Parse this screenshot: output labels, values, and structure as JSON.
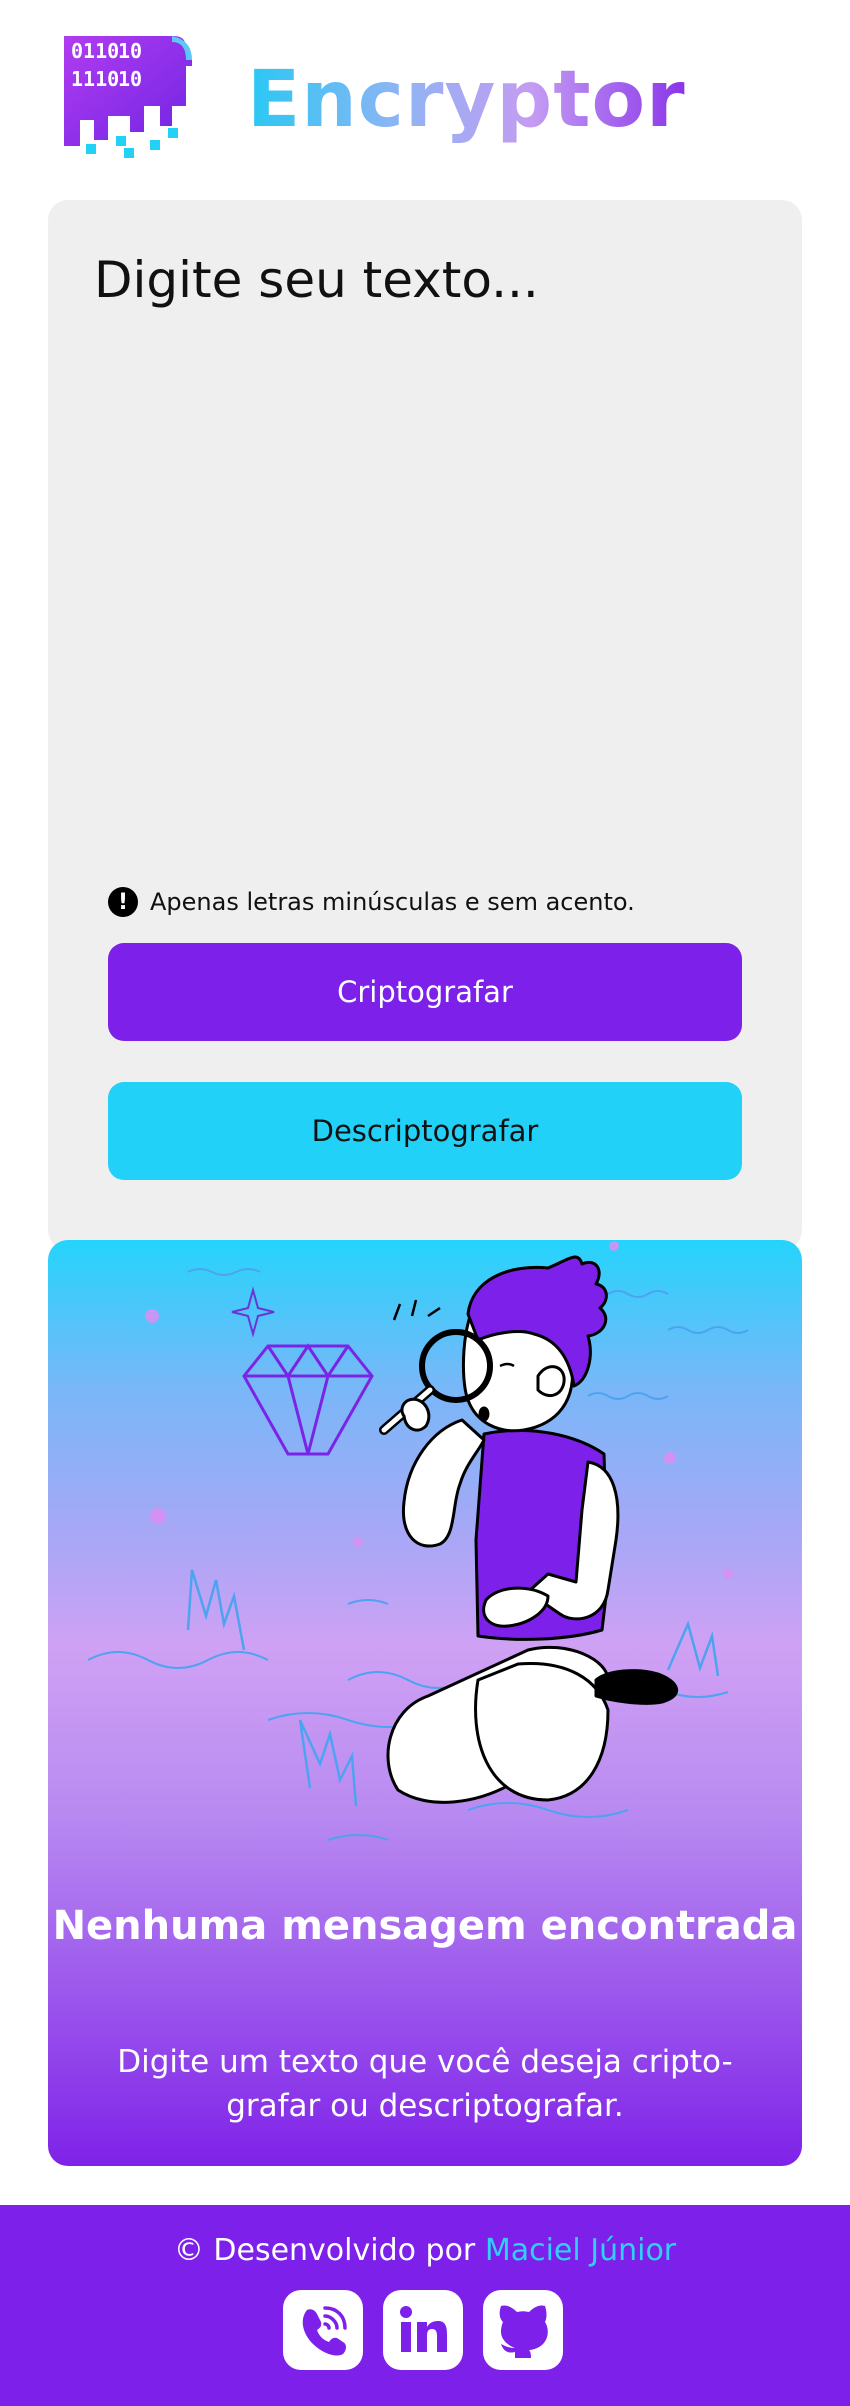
{
  "header": {
    "brand": "Encryptor",
    "logo_bits_row1": "0110",
    "logo_bits_row2": "1110"
  },
  "input": {
    "placeholder": "Digite seu texto...",
    "value": "",
    "hint": "Apenas letras minúsculas e sem acento.",
    "hint_icon": "exclamation-icon",
    "encrypt_label": "Criptografar",
    "decrypt_label": "Descriptografar"
  },
  "output": {
    "title": "Nenhuma mensagem encontrada",
    "description": "Digite um texto que você deseja cripto-grafar ou descriptografar."
  },
  "footer": {
    "credit_prefix": "© Desenvolvido por",
    "author": "Maciel Júnior",
    "social": [
      "phone-icon",
      "linkedin-icon",
      "github-icon"
    ]
  },
  "colors": {
    "primary": "#7c20ea",
    "accent": "#22d1f8",
    "card_bg": "#efefef"
  }
}
